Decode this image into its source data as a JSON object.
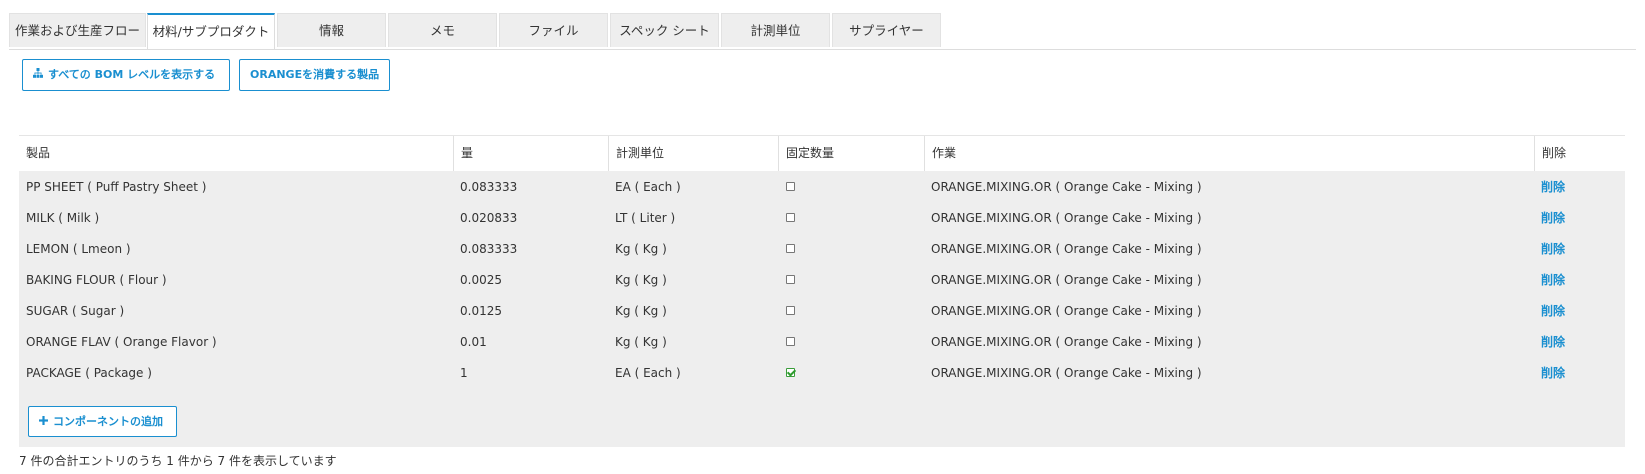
{
  "tabs": [
    {
      "label": "作業および生産フロー",
      "active": false
    },
    {
      "label": "材料/サブプロダクト",
      "active": true
    },
    {
      "label": "情報",
      "active": false
    },
    {
      "label": "メモ",
      "active": false
    },
    {
      "label": "ファイル",
      "active": false
    },
    {
      "label": "スペック シート",
      "active": false
    },
    {
      "label": "計測単位",
      "active": false
    },
    {
      "label": "サプライヤー",
      "active": false
    }
  ],
  "toolbar": {
    "show_bom_label": "すべての BOM レベルを表示する",
    "show_bom_icon": "sitemap-icon",
    "consuming_label": "ORANGEを消費する製品"
  },
  "table": {
    "headers": {
      "product": "製品",
      "qty": "量",
      "uom": "計測単位",
      "fixed": "固定数量",
      "operation": "作業",
      "delete": "削除"
    },
    "rows": [
      {
        "product": "PP SHEET ( Puff Pastry Sheet )",
        "qty": "0.083333",
        "uom": "EA ( Each )",
        "fixed": false,
        "operation": "ORANGE.MIXING.OR ( Orange Cake - Mixing )",
        "delete": "削除"
      },
      {
        "product": "MILK ( Milk )",
        "qty": "0.020833",
        "uom": "LT ( Liter )",
        "fixed": false,
        "operation": "ORANGE.MIXING.OR ( Orange Cake - Mixing )",
        "delete": "削除"
      },
      {
        "product": "LEMON ( Lmeon )",
        "qty": "0.083333",
        "uom": "Kg ( Kg )",
        "fixed": false,
        "operation": "ORANGE.MIXING.OR ( Orange Cake - Mixing )",
        "delete": "削除"
      },
      {
        "product": "BAKING FLOUR ( Flour )",
        "qty": "0.0025",
        "uom": "Kg ( Kg )",
        "fixed": false,
        "operation": "ORANGE.MIXING.OR ( Orange Cake - Mixing )",
        "delete": "削除"
      },
      {
        "product": "SUGAR ( Sugar )",
        "qty": "0.0125",
        "uom": "Kg ( Kg )",
        "fixed": false,
        "operation": "ORANGE.MIXING.OR ( Orange Cake - Mixing )",
        "delete": "削除"
      },
      {
        "product": "ORANGE FLAV ( Orange Flavor )",
        "qty": "0.01",
        "uom": "Kg ( Kg )",
        "fixed": false,
        "operation": "ORANGE.MIXING.OR ( Orange Cake - Mixing )",
        "delete": "削除"
      },
      {
        "product": "PACKAGE ( Package )",
        "qty": "1",
        "uom": "EA ( Each )",
        "fixed": true,
        "operation": "ORANGE.MIXING.OR ( Orange Cake - Mixing )",
        "delete": "削除"
      }
    ],
    "add_component_label": "コンポーネントの追加",
    "add_component_icon": "plus-icon"
  },
  "footer": {
    "entries_text": "7 件の合計エントリのうち 1 件から 7 件を表示しています"
  },
  "colors": {
    "accent": "#1a8fd0",
    "checked": "#2e9b2e",
    "grid_bg": "#eeeeee"
  }
}
